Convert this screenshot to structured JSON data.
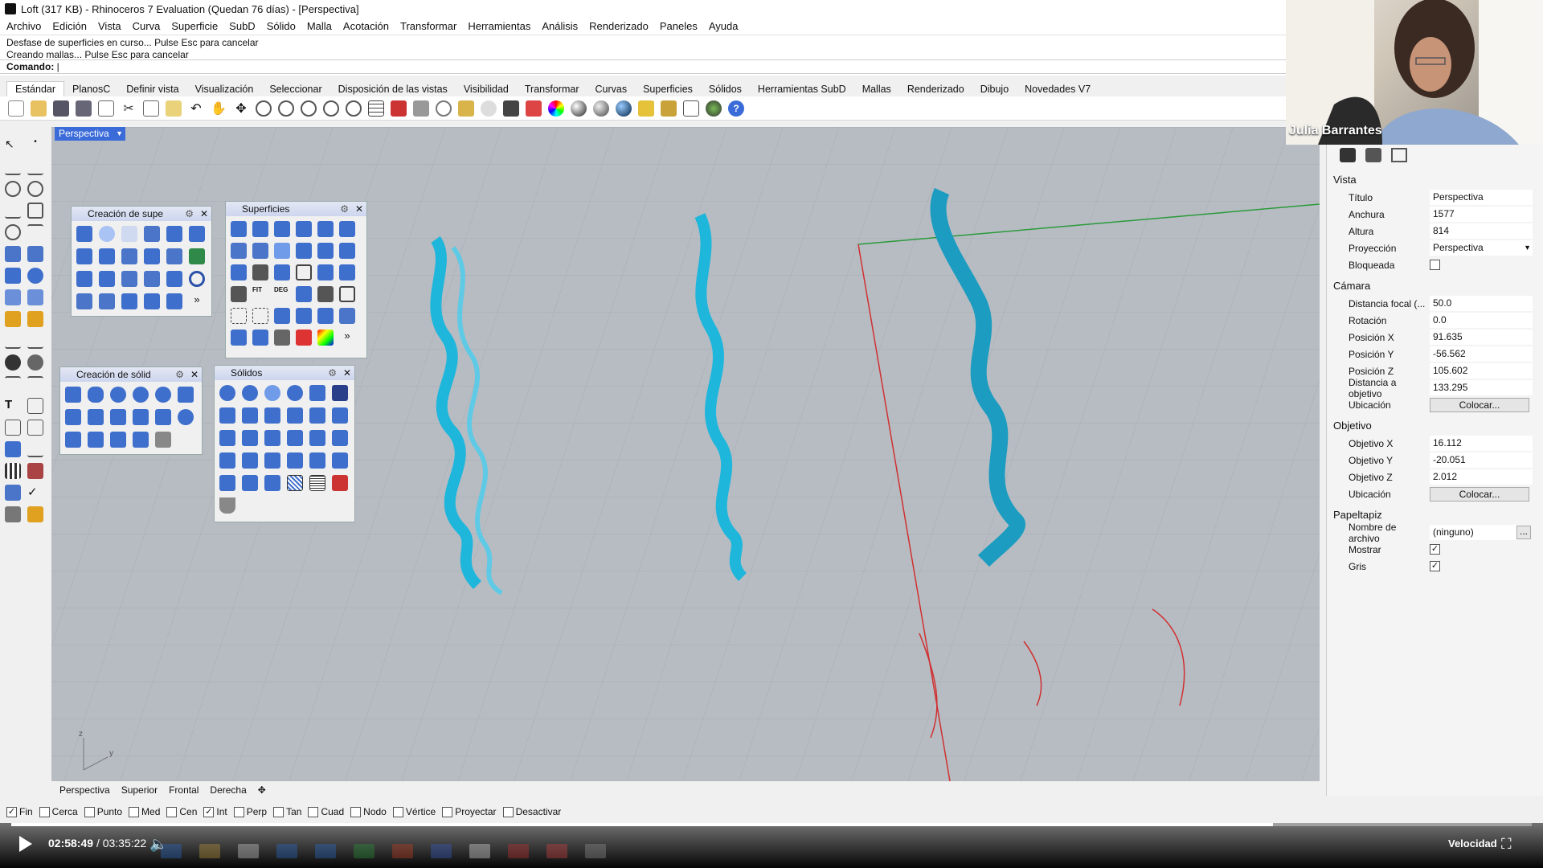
{
  "window": {
    "title": "Loft (317 KB) - Rhinoceros 7 Evaluation (Quedan 76 días) - [Perspectiva]"
  },
  "menu": [
    "Archivo",
    "Edición",
    "Vista",
    "Curva",
    "Superficie",
    "SubD",
    "Sólido",
    "Malla",
    "Acotación",
    "Transformar",
    "Herramientas",
    "Análisis",
    "Renderizado",
    "Paneles",
    "Ayuda"
  ],
  "command": {
    "history": [
      "Desfase de superficies en curso... Pulse Esc para cancelar",
      "Creando mallas... Pulse Esc para cancelar"
    ],
    "prompt_label": "Comando:"
  },
  "toolbar_tabs": [
    "Estándar",
    "PlanosC",
    "Definir vista",
    "Visualización",
    "Seleccionar",
    "Disposición de las vistas",
    "Visibilidad",
    "Transformar",
    "Curvas",
    "Superficies",
    "Sólidos",
    "Herramientas SubD",
    "Mallas",
    "Renderizado",
    "Dibujo",
    "Novedades V7"
  ],
  "viewport": {
    "name": "Perspectiva"
  },
  "floating_panels": {
    "creacion_sup": "Creación de supe",
    "superficies": "Superficies",
    "creacion_solid": "Creación de sólid",
    "solidos": "Sólidos"
  },
  "properties": {
    "vista_title": "Vista",
    "titulo_label": "Título",
    "titulo": "Perspectiva",
    "anchura_label": "Anchura",
    "anchura": "1577",
    "altura_label": "Altura",
    "altura": "814",
    "proyeccion_label": "Proyección",
    "proyeccion": "Perspectiva",
    "bloqueada_label": "Bloqueada",
    "camara_title": "Cámara",
    "focal_label": "Distancia focal (...",
    "focal": "50.0",
    "rotacion_label": "Rotación",
    "rotacion": "0.0",
    "posx_label": "Posición X",
    "posx": "91.635",
    "posy_label": "Posición Y",
    "posy": "-56.562",
    "posz_label": "Posición Z",
    "posz": "105.602",
    "dist_label": "Distancia a objetivo",
    "dist": "133.295",
    "ubic_label": "Ubicación",
    "colocar": "Colocar...",
    "objetivo_title": "Objetivo",
    "objx_label": "Objetivo X",
    "objx": "16.112",
    "objy_label": "Objetivo Y",
    "objy": "-20.051",
    "objz_label": "Objetivo Z",
    "objz": "2.012",
    "papel_title": "Papeltapiz",
    "archivo_label": "Nombre de archivo",
    "archivo": "(ninguno)",
    "mostrar_label": "Mostrar",
    "gris_label": "Gris"
  },
  "viewport_tabs": [
    "Perspectiva",
    "Superior",
    "Frontal",
    "Derecha"
  ],
  "osnaps": [
    {
      "label": "Fin",
      "checked": true
    },
    {
      "label": "Cerca",
      "checked": false
    },
    {
      "label": "Punto",
      "checked": false
    },
    {
      "label": "Med",
      "checked": false
    },
    {
      "label": "Cen",
      "checked": false
    },
    {
      "label": "Int",
      "checked": true
    },
    {
      "label": "Perp",
      "checked": false
    },
    {
      "label": "Tan",
      "checked": false
    },
    {
      "label": "Cuad",
      "checked": false
    },
    {
      "label": "Nodo",
      "checked": false
    },
    {
      "label": "Vértice",
      "checked": false
    },
    {
      "label": "Proyectar",
      "checked": false
    },
    {
      "label": "Desactivar",
      "checked": false
    }
  ],
  "player": {
    "current": "02:58:49",
    "total": "/ 03:35:22",
    "speed_label": "Velocidad",
    "progress": 0.83
  },
  "webcam": {
    "name": "Julia Barrantes"
  },
  "colors": {
    "accent": "#3b6bd8",
    "surface": "#1fb6dc",
    "x_axis": "#d03030",
    "y_axis": "#2a9a3a"
  }
}
